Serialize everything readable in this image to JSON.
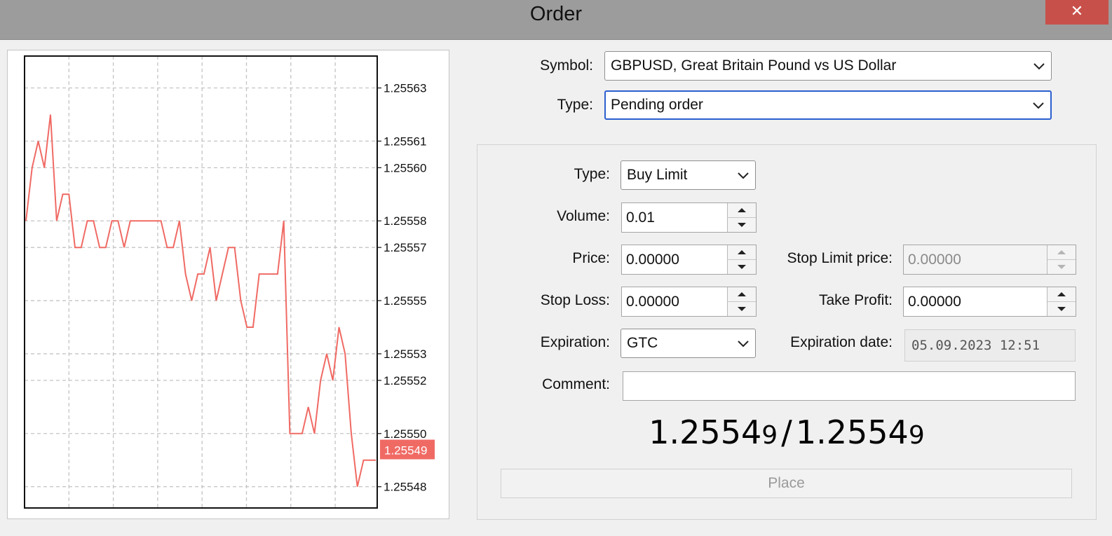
{
  "window": {
    "title": "Order",
    "close_glyph": "✕"
  },
  "chart_data": {
    "type": "line",
    "title": "",
    "y_ticks": [
      "1.25563",
      "1.25561",
      "1.25560",
      "1.25558",
      "1.25557",
      "1.25555",
      "1.25553",
      "1.25552",
      "1.25550",
      "1.25548"
    ],
    "ylim": [
      1.255472,
      1.255642
    ],
    "grid": true,
    "line_color": "#f06a64",
    "current_price_label": "1.25549",
    "current_price": 1.255494,
    "series": [
      {
        "values": [
          1.25558,
          1.2556,
          1.25561,
          1.2556,
          1.25562,
          1.25558,
          1.25559,
          1.25559,
          1.25557,
          1.25557,
          1.25558,
          1.25558,
          1.25557,
          1.25557,
          1.25558,
          1.25558,
          1.25557,
          1.25558,
          1.25558,
          1.25558,
          1.25558,
          1.25558,
          1.25558,
          1.25557,
          1.25557,
          1.25558,
          1.25556,
          1.25555,
          1.25556,
          1.25556,
          1.25557,
          1.25555,
          1.25556,
          1.25557,
          1.25557,
          1.25555,
          1.25554,
          1.25554,
          1.25556,
          1.25556,
          1.25556,
          1.25556,
          1.25558,
          1.2555,
          1.2555,
          1.2555,
          1.25551,
          1.2555,
          1.25552,
          1.25553,
          1.25552,
          1.25554,
          1.25553,
          1.2555,
          1.25548,
          1.25549,
          1.25549,
          1.25549
        ]
      }
    ]
  },
  "form": {
    "symbol_label": "Symbol:",
    "symbol_value": "GBPUSD, Great Britain Pound vs US Dollar",
    "type_label": "Type:",
    "type_value": "Pending order",
    "order_type_label": "Type:",
    "order_type_value": "Buy Limit",
    "volume_label": "Volume:",
    "volume_value": "0.01",
    "price_label": "Price:",
    "price_value": "0.00000",
    "stop_limit_label": "Stop Limit price:",
    "stop_limit_value": "0.00000",
    "stop_loss_label": "Stop Loss:",
    "stop_loss_value": "0.00000",
    "take_profit_label": "Take Profit:",
    "take_profit_value": "0.00000",
    "expiration_label": "Expiration:",
    "expiration_value": "GTC",
    "expiration_date_label": "Expiration date:",
    "expiration_date_value": "05.09.2023 12:51",
    "comment_label": "Comment:",
    "comment_value": ""
  },
  "quote": {
    "bid_main": "1.2554",
    "bid_last": "9",
    "separator": "/",
    "ask_main": "1.2554",
    "ask_last": "9"
  },
  "place_button": "Place"
}
